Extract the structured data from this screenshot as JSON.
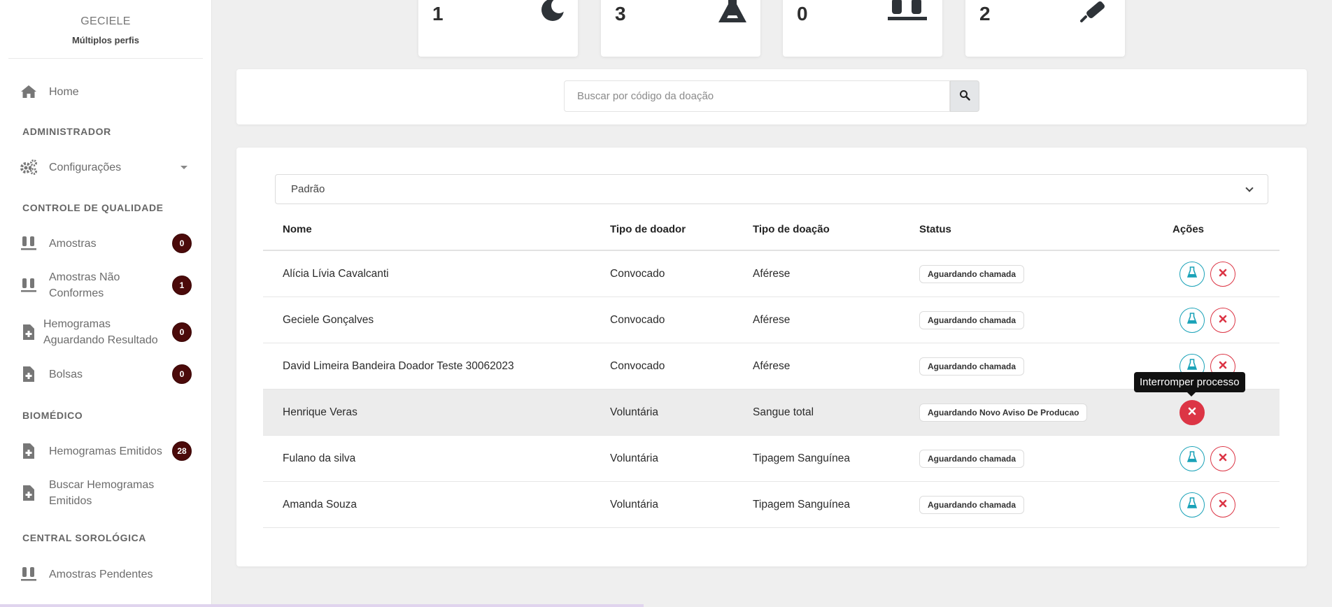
{
  "user": {
    "name": "GECIELE",
    "role": "Múltiplos perfis"
  },
  "sidebar": {
    "home": {
      "label": "Home",
      "icon": "home-icon"
    },
    "sections": {
      "admin": "ADMINISTRADOR",
      "quality": "CONTROLE DE QUALIDADE",
      "biomedico": "BIOMÉDICO",
      "sorologica": "CENTRAL SOROLÓGICA"
    },
    "config": {
      "label": "Configurações",
      "icon": "gears-icon"
    },
    "amostras": {
      "label": "Amostras",
      "badge": "0",
      "icon": "test-tubes-icon"
    },
    "amostras_nc": {
      "label": "Amostras Não Conformes",
      "badge": "1",
      "icon": "test-tubes-icon"
    },
    "hemogramas_aguardando": {
      "label": "Hemogramas Aguardando Resultado",
      "badge": "0",
      "icon": "file-medical-icon"
    },
    "bolsas": {
      "label": "Bolsas",
      "badge": "0",
      "icon": "file-medical-icon"
    },
    "hemogramas_emitidos": {
      "label": "Hemogramas Emitidos",
      "badge": "28",
      "icon": "file-medical-icon"
    },
    "buscar_hemogramas": {
      "label": "Buscar Hemogramas Emitidos",
      "icon": "file-medical-icon"
    },
    "amostras_pendentes": {
      "label": "Amostras Pendentes",
      "icon": "test-tubes-icon"
    }
  },
  "stats": [
    {
      "value": "1",
      "icon": "moon-icon"
    },
    {
      "value": "3",
      "icon": "flask-icon"
    },
    {
      "value": "0",
      "icon": "test-tubes-icon"
    },
    {
      "value": "2",
      "icon": "syringe-icon"
    }
  ],
  "search": {
    "placeholder": "Buscar por código da doação",
    "value": ""
  },
  "filter": {
    "selected": "Padrão"
  },
  "table": {
    "headers": {
      "nome": "Nome",
      "tipo_doador": "Tipo de doador",
      "tipo_doacao": "Tipo de doação",
      "status": "Status",
      "acoes": "Ações"
    },
    "rows": [
      {
        "nome": "Alícia Lívia Cavalcanti",
        "tipo_doador": "Convocado",
        "tipo_doacao": "Aférese",
        "status": "Aguardando chamada"
      },
      {
        "nome": "Geciele Gonçalves",
        "tipo_doador": "Convocado",
        "tipo_doacao": "Aférese",
        "status": "Aguardando chamada"
      },
      {
        "nome": "David Limeira Bandeira Doador Teste 30062023",
        "tipo_doador": "Convocado",
        "tipo_doacao": "Aférese",
        "status": "Aguardando chamada"
      },
      {
        "nome": "Henrique Veras",
        "tipo_doador": "Voluntária",
        "tipo_doacao": "Sangue total",
        "status": "Aguardando Novo Aviso De Producao"
      },
      {
        "nome": "Fulano da silva",
        "tipo_doador": "Voluntária",
        "tipo_doacao": "Tipagem Sanguínea",
        "status": "Aguardando chamada"
      },
      {
        "nome": "Amanda Souza",
        "tipo_doador": "Voluntária",
        "tipo_doacao": "Tipagem Sanguínea",
        "status": "Aguardando chamada"
      }
    ]
  },
  "tooltip": {
    "text": "Interromper processo"
  },
  "colors": {
    "badge": "#4b0a0a",
    "info": "#1aa2b8",
    "danger": "#dc3545"
  }
}
